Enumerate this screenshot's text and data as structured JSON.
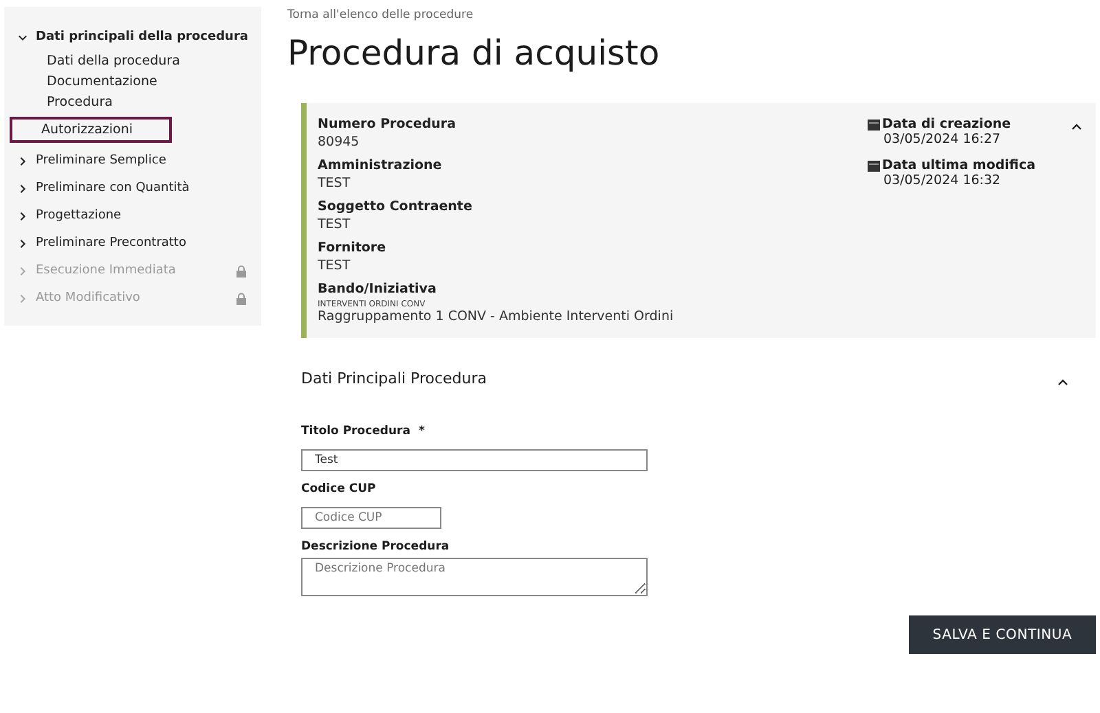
{
  "sidebar": {
    "items": [
      {
        "label": "Dati principali della procedura",
        "expanded": true,
        "disabled": false,
        "children": [
          {
            "label": "Dati della procedura",
            "selected": false
          },
          {
            "label": "Documentazione",
            "selected": false
          },
          {
            "label": "Procedura",
            "selected": false
          },
          {
            "label": "Autorizzazioni",
            "selected": true
          }
        ]
      },
      {
        "label": "Preliminare Semplice",
        "expanded": false,
        "disabled": false
      },
      {
        "label": "Preliminare con Quantità",
        "expanded": false,
        "disabled": false
      },
      {
        "label": "Progettazione",
        "expanded": false,
        "disabled": false
      },
      {
        "label": "Preliminare Precontratto",
        "expanded": false,
        "disabled": false
      },
      {
        "label": "Esecuzione Immediata",
        "expanded": false,
        "disabled": true
      },
      {
        "label": "Atto Modificativo",
        "expanded": false,
        "disabled": true
      }
    ]
  },
  "back_link": "Torna all'elenco delle procedure",
  "title": "Procedura di acquisto",
  "summary": {
    "expanded": true,
    "fields": [
      {
        "label": "Numero Procedura",
        "value": "80945"
      },
      {
        "label": "Amministrazione",
        "value": "TEST"
      },
      {
        "label": "Soggetto Contraente",
        "value": "TEST"
      },
      {
        "label": "Fornitore",
        "value": "TEST"
      },
      {
        "label": "Bando/Iniziativa",
        "note": "INTERVENTI ORDINI CONV",
        "value": "Raggruppamento 1 CONV - Ambiente Interventi Ordini"
      }
    ],
    "dates": [
      {
        "label": "Data di creazione",
        "value": "03/05/2024 16:27"
      },
      {
        "label": "Data ultima modifica",
        "value": "03/05/2024 16:32"
      }
    ]
  },
  "form": {
    "title": "Dati Principali Procedura",
    "expanded": true,
    "fields": [
      {
        "kind": "wide_input",
        "label": "Titolo Procedura",
        "required": true,
        "value": "Test"
      },
      {
        "kind": "narrow_input",
        "label": "Codice CUP",
        "required": false,
        "placeholder": "Codice CUP"
      },
      {
        "kind": "textarea",
        "label": "Descrizione Procedura",
        "required": false,
        "placeholder": "Descrizione Procedura"
      }
    ],
    "required_mark": "*"
  },
  "submit_button": "SALVA E CONTINUA"
}
